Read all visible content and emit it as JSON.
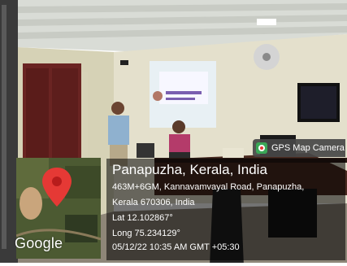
{
  "badge": {
    "icon": "camera-icon",
    "label": "GPS Map Camera"
  },
  "location": {
    "place": "Panapuzha, Kerala, India",
    "address_line1": "463M+6GM, Kannavamvayal Road, Panapuzha,",
    "address_line2": "Kerala 670306, India",
    "lat": "Lat 12.102867°",
    "long": "Long 75.234129°",
    "datetime": "05/12/22 10:35 AM GMT +05:30"
  },
  "map": {
    "logo": "Google",
    "icon": "map-pin-icon"
  },
  "colors": {
    "wall": "#e4e0cc",
    "door": "#6a2422",
    "overlay": "#000000",
    "pin": "#e53935"
  }
}
